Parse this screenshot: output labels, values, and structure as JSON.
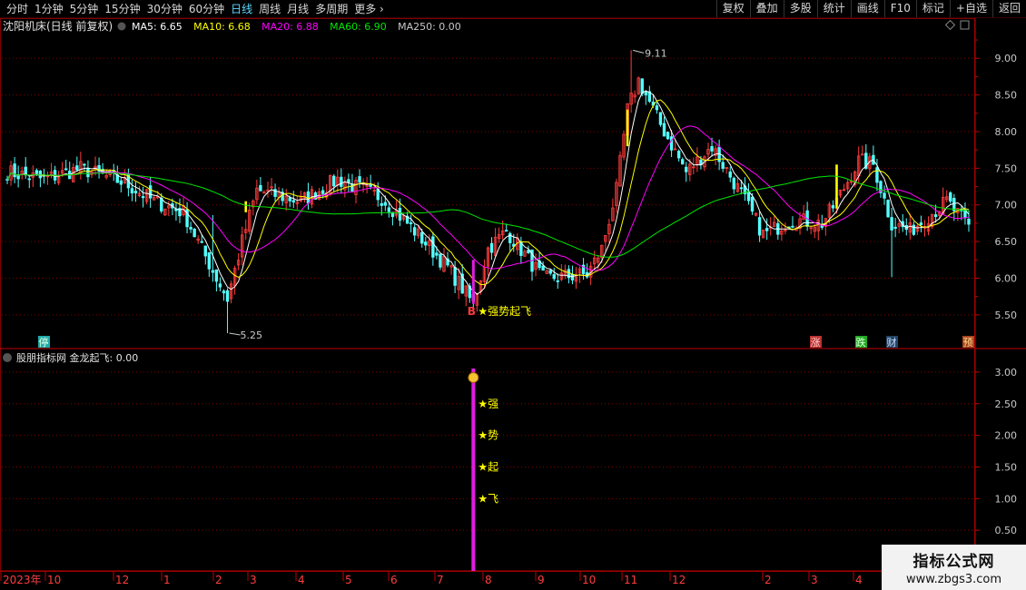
{
  "toolbar": {
    "period_tabs": [
      "分时",
      "1分钟",
      "5分钟",
      "15分钟",
      "30分钟",
      "60分钟",
      "日线",
      "周线",
      "月线",
      "多周期",
      "更多"
    ],
    "active_tab": "日线",
    "buttons": [
      "复权",
      "叠加",
      "多股",
      "统计",
      "画线",
      "F10",
      "标记",
      "+自选",
      "返回"
    ]
  },
  "colors": {
    "background": "#000000",
    "up": "#ff3c3c",
    "down": "#54ffff",
    "ma5": "#ffffff",
    "ma10": "#ffff00",
    "ma20": "#ff00ff",
    "ma60": "#00e600",
    "ma250": "#c8c8c8",
    "grid": "#800000",
    "signal": "#ffff00",
    "indicator_bar": "#e01ee0"
  },
  "chart_data": [
    {
      "type": "candlestick",
      "title": "沈阳机床(日线 前复权)",
      "legend": [
        {
          "name": "MA5",
          "value": "6.65"
        },
        {
          "name": "MA10",
          "value": "6.68"
        },
        {
          "name": "MA20",
          "value": "6.88"
        },
        {
          "name": "MA60",
          "value": "6.90"
        },
        {
          "name": "MA250",
          "value": "0.00"
        }
      ],
      "ylim": [
        5.3,
        9.3
      ],
      "y_ticks": [
        "9.00",
        "8.50",
        "8.00",
        "7.50",
        "7.00",
        "6.50",
        "6.00",
        "5.50"
      ],
      "x_ticks": [
        "2023年",
        "10",
        "12",
        "1",
        "2",
        "3",
        "4",
        "5",
        "6",
        "7",
        "8",
        "9",
        "10",
        "11",
        "12",
        "2",
        "3",
        "4"
      ],
      "anchors": [
        {
          "t": 0,
          "p": 7.45
        },
        {
          "t": 10,
          "p": 7.35
        },
        {
          "t": 20,
          "p": 7.5
        },
        {
          "t": 32,
          "p": 7.3
        },
        {
          "t": 40,
          "p": 7.05
        },
        {
          "t": 48,
          "p": 6.9
        },
        {
          "t": 56,
          "p": 6.1
        },
        {
          "t": 60,
          "p": 5.72
        },
        {
          "t": 64,
          "p": 6.5
        },
        {
          "t": 68,
          "p": 7.2
        },
        {
          "t": 80,
          "p": 7.05
        },
        {
          "t": 90,
          "p": 7.35
        },
        {
          "t": 102,
          "p": 7.1
        },
        {
          "t": 110,
          "p": 6.7
        },
        {
          "t": 120,
          "p": 6.15
        },
        {
          "t": 127,
          "p": 5.65
        },
        {
          "t": 131,
          "p": 6.4
        },
        {
          "t": 136,
          "p": 6.65
        },
        {
          "t": 146,
          "p": 6.0
        },
        {
          "t": 158,
          "p": 6.05
        },
        {
          "t": 162,
          "p": 6.4
        },
        {
          "t": 166,
          "p": 7.2
        },
        {
          "t": 169,
          "p": 8.3
        },
        {
          "t": 172,
          "p": 8.7
        },
        {
          "t": 178,
          "p": 8.1
        },
        {
          "t": 185,
          "p": 7.45
        },
        {
          "t": 192,
          "p": 7.8
        },
        {
          "t": 200,
          "p": 7.15
        },
        {
          "t": 206,
          "p": 6.6
        },
        {
          "t": 214,
          "p": 6.8
        },
        {
          "t": 222,
          "p": 6.75
        },
        {
          "t": 226,
          "p": 7.05
        },
        {
          "t": 232,
          "p": 7.6
        },
        {
          "t": 236,
          "p": 7.55
        },
        {
          "t": 241,
          "p": 6.75
        },
        {
          "t": 246,
          "p": 6.65
        },
        {
          "t": 256,
          "p": 7.05
        },
        {
          "t": 262,
          "p": 6.7
        }
      ],
      "high_label": "9.11",
      "low_label": "5.25",
      "signal_label": "★强势起飞",
      "signal_marker": "B",
      "event_markers": [
        "停",
        "涨",
        "跌",
        "财",
        "预"
      ]
    },
    {
      "type": "bar",
      "title": "股朋指标网 金龙起飞: 0.00",
      "ylim": [
        0,
        3.2
      ],
      "y_ticks": [
        "3.00",
        "2.50",
        "2.00",
        "1.50",
        "1.00",
        "0.50"
      ],
      "signal_value": 3.0,
      "signal_chars": [
        "强",
        "势",
        "起",
        "飞"
      ],
      "signal_char_levels": [
        2.5,
        2.0,
        1.5,
        1.0
      ]
    }
  ],
  "watermark": {
    "line1": "指标公式网",
    "line2": "www.zbgs3.com"
  }
}
